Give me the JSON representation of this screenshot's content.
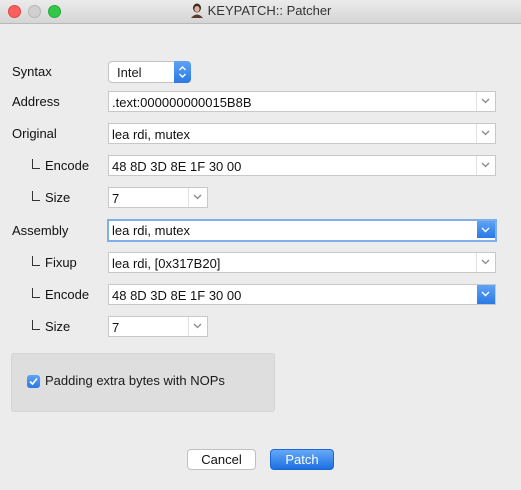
{
  "window": {
    "title": "KEYPATCH:: Patcher"
  },
  "form": {
    "syntax": {
      "label": "Syntax",
      "value": "Intel"
    },
    "address": {
      "label": "Address",
      "value": ".text:000000000015B8B"
    },
    "original": {
      "label": "Original",
      "value": "lea rdi, mutex"
    },
    "original_encode": {
      "label": "Encode",
      "value": "48 8D 3D 8E 1F 30 00"
    },
    "original_size": {
      "label": "Size",
      "value": "7"
    },
    "assembly": {
      "label": "Assembly",
      "value": "lea rdi, mutex"
    },
    "fixup": {
      "label": "Fixup",
      "value": "lea rdi, [0x317B20]"
    },
    "assembly_encode": {
      "label": "Encode",
      "value": "48 8D 3D 8E 1F 30 00"
    },
    "assembly_size": {
      "label": "Size",
      "value": "7"
    }
  },
  "options": {
    "padding_label": "Padding extra bytes with NOPs",
    "padding_checked": true
  },
  "buttons": {
    "cancel": "Cancel",
    "patch": "Patch"
  },
  "colors": {
    "accent": "#2a79e4",
    "close": "#fc605c",
    "maximize": "#34c84a"
  }
}
